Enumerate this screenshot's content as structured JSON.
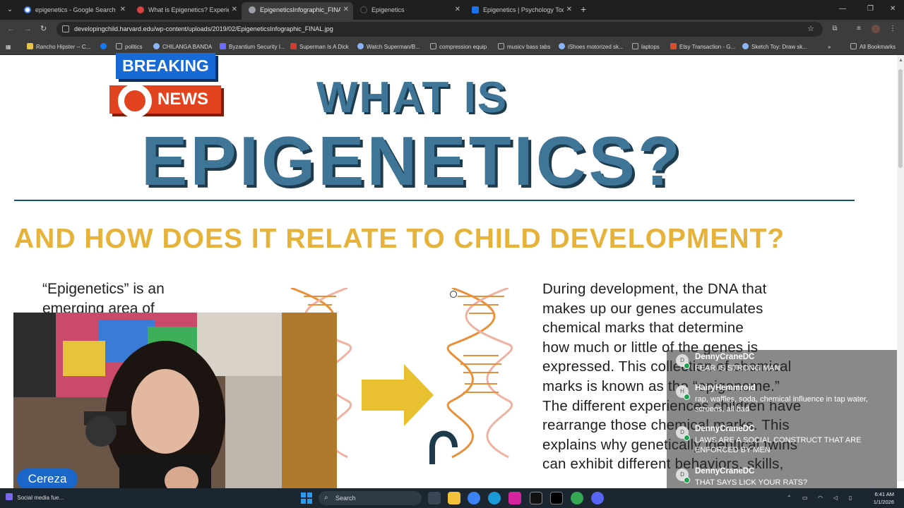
{
  "browser": {
    "tabs": [
      {
        "title": "epigenetics - Google Search",
        "favicon_color": "#ffffff",
        "active": false
      },
      {
        "title": "What is Epigenetics? Experience",
        "favicon_color": "#d94343",
        "active": false
      },
      {
        "title": "EpigeneticsInfographic_FINAL.jp",
        "favicon_color": "#9aa0a6",
        "active": true
      },
      {
        "title": "Epigenetics",
        "favicon_color": "#1f1f1f",
        "active": false
      },
      {
        "title": "Epigenetics | Psychology Today",
        "favicon_color": "#1a73e8",
        "active": false
      }
    ],
    "url": "developingchild.harvard.edu/wp-content/uploads/2019/02/EpigeneticsInfographic_FINAL.jpg",
    "bookmarks": [
      {
        "label": "Rancho Hipster -- C...",
        "color": "#e8c34a"
      },
      {
        "label": "",
        "color": "#1877f2"
      },
      {
        "label": "politics",
        "color": "#a8b0b8"
      },
      {
        "label": "CHILANGA BANDA",
        "color": "#8ab4f8"
      },
      {
        "label": "Byzantium Security I...",
        "color": "#6b6bff"
      },
      {
        "label": "Superman Is A Dick",
        "color": "#d33b2c"
      },
      {
        "label": "Watch Superman/B...",
        "color": "#8ab4f8"
      },
      {
        "label": "compression equip",
        "color": "#a8b0b8"
      },
      {
        "label": "musicv bass tabs",
        "color": "#a8b0b8"
      },
      {
        "label": "iShoes motorized sk...",
        "color": "#8ab4f8"
      },
      {
        "label": "laptops",
        "color": "#a8b0b8"
      },
      {
        "label": "Etsy Transaction - G...",
        "color": "#e04b2a"
      },
      {
        "label": "Sketch Toy: Draw sk...",
        "color": "#8ab4f8"
      }
    ],
    "all_bookmarks_label": "All Bookmarks"
  },
  "infographic": {
    "title_line1": "WHAT IS",
    "title_line2": "EPIGENETICS?",
    "subtitle": "AND HOW DOES IT RELATE TO CHILD DEVELOPMENT?",
    "left_text": "“Epigenetics” is an emerging area of",
    "right_lines": [
      "During development, the DNA that",
      "makes up our genes accumulates",
      "chemical marks that determine",
      "how much or little of the genes is",
      "expressed. This collection of chemical",
      "marks is known as the “epigenome.”",
      "The different experiences children have",
      "rearrange those chemical marks. This",
      "explains why genetically identical twins",
      "can exhibit different behaviors, skills,"
    ],
    "colors": {
      "blue": "#3f7596",
      "gold": "#e6b23a",
      "dna_orange": "#e8913a"
    }
  },
  "overlay": {
    "breaking_label": "BREAKING",
    "news_label": "NEWS",
    "streamer_name": "Cereza",
    "chat": [
      {
        "initial": "D",
        "user": "DennyCraneDC",
        "text": "FEAR IS STRONG MAN"
      },
      {
        "initial": "H",
        "user": "HairyHemmroid",
        "text": "rap, waffles, soda, chemical influence in tap water, screens, all bad"
      },
      {
        "initial": "D",
        "user": "DennyCraneDC",
        "text": "LAWS ARE A SOCIAL CONSTRUCT THAT ARE ENFORCED BY MEN"
      },
      {
        "initial": "D",
        "user": "DennyCraneDC",
        "text": "THAT SAYS LICK YOUR RATS?"
      }
    ]
  },
  "taskbar": {
    "weather_text": "Social media fue...",
    "search_placeholder": "Search",
    "time": "6:41 AM",
    "date": "1/1/2026"
  }
}
